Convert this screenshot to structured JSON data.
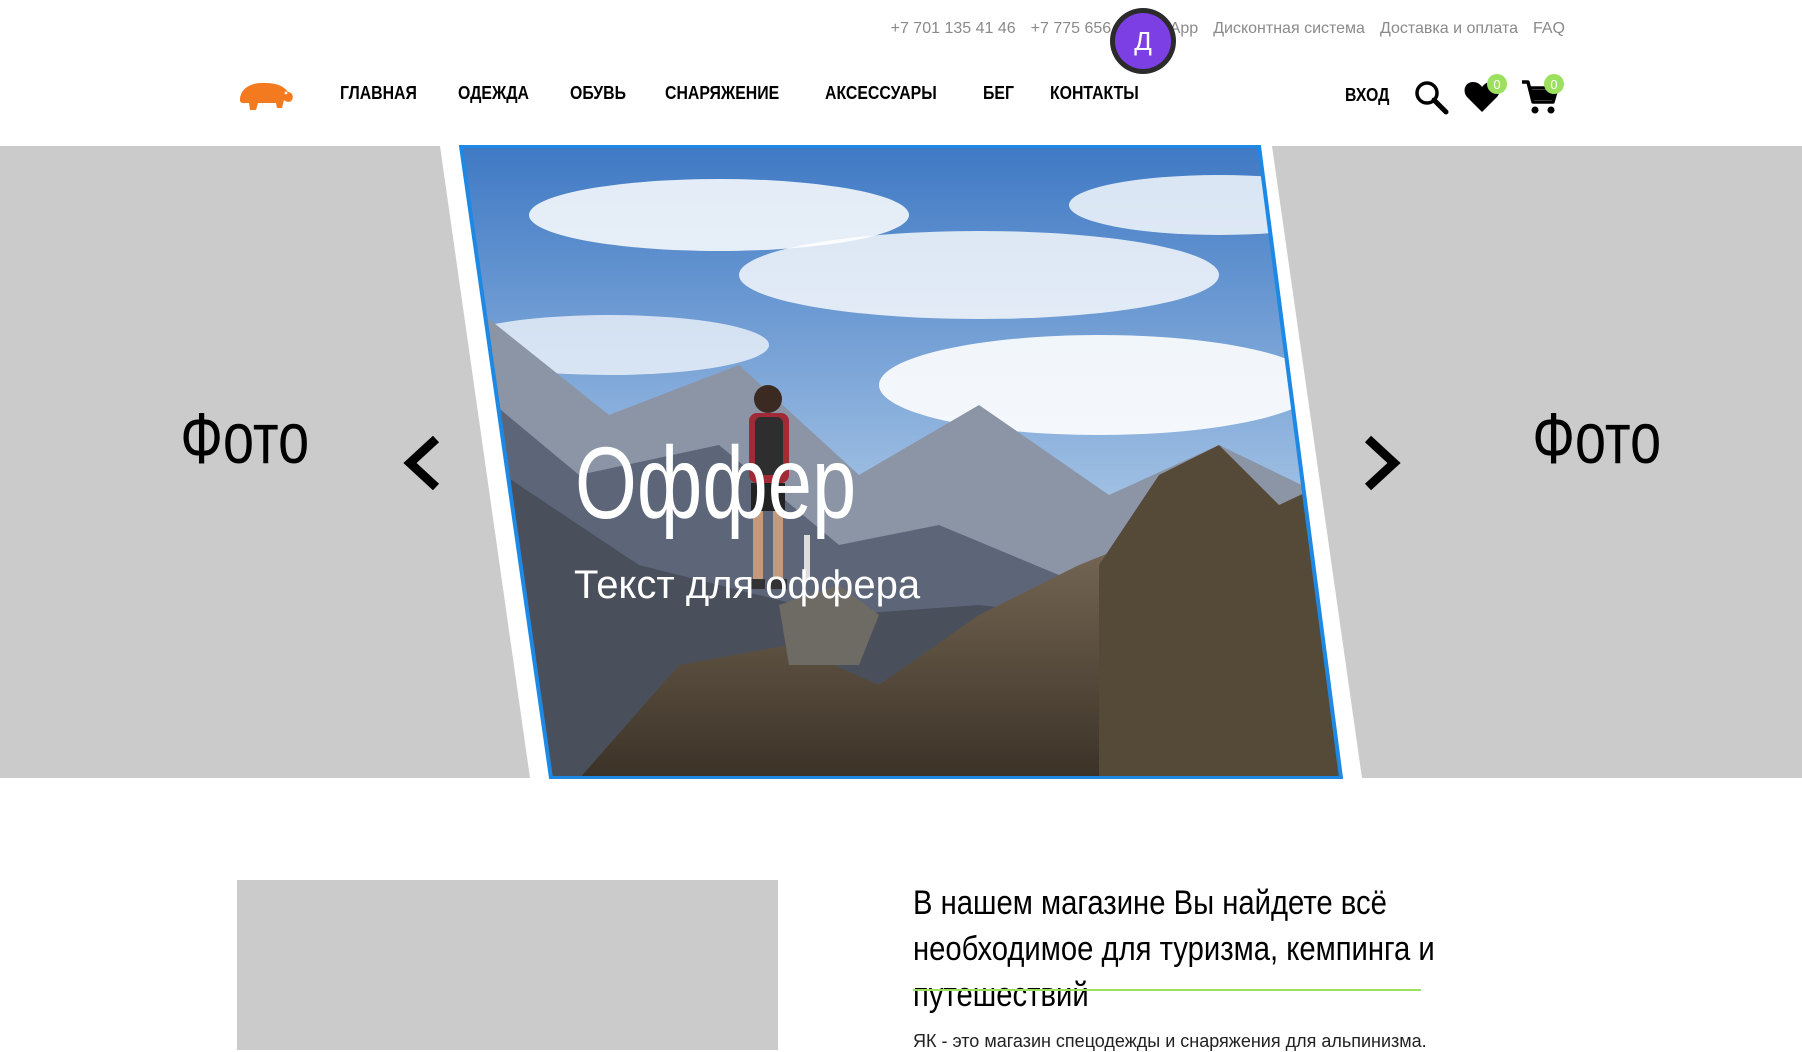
{
  "topbar": {
    "phone1": "+7 701 135 41 46",
    "phone2": "+7 775 656 48 2",
    "whatsapp": "sApp",
    "discount": "Дисконтная система",
    "delivery": "Доставка и оплата",
    "faq": "FAQ"
  },
  "avatar": {
    "letter": "Д",
    "color": "#7b3fe4"
  },
  "nav": {
    "items": [
      "ГЛАВНАЯ",
      "ОДЕЖДА",
      "ОБУВЬ",
      "СНАРЯЖЕНИЕ",
      "АКСЕССУАРЫ",
      "БЕГ",
      "КОНТАКТЫ"
    ],
    "login": "ВХОД",
    "wishlist_count": "0",
    "cart_count": "0"
  },
  "hero": {
    "left_label": "Фото",
    "right_label": "Фото",
    "offer_title": "Оффер",
    "offer_text": "Текст для оффера"
  },
  "about": {
    "title": "В нашем магазине Вы найдете всё необходимое для туризма, кемпинга и путешествий",
    "text": "ЯК - это магазин спецодежды и снаряжения для альпинизма."
  },
  "colors": {
    "brand_orange": "#f47a20",
    "accent_green": "#9be15d",
    "frame_blue": "#1e88e5",
    "placeholder_gray": "#cbcbcb"
  }
}
